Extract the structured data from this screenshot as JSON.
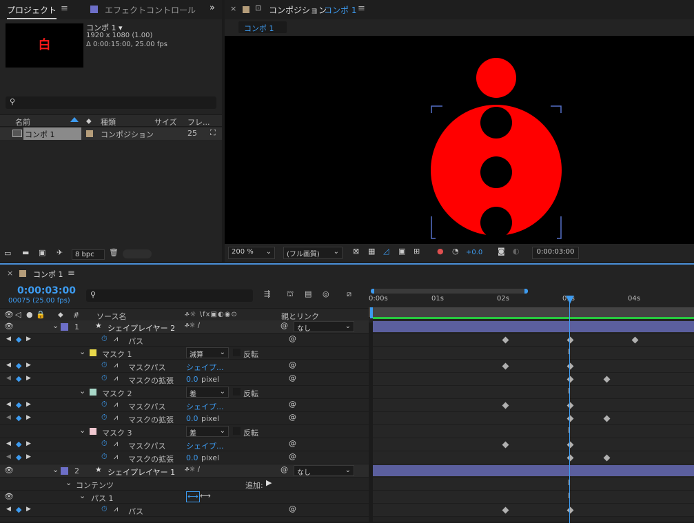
{
  "project_panel": {
    "tab_project": "プロジェクト",
    "tab_effect": "エフェクトコントロール ミ",
    "thumb_char": "白",
    "comp_name": "コンポ 1 ▾",
    "comp_res": "1920 x 1080 (1.00)",
    "comp_dur": "Δ 0:00:15:00, 25.00 fps",
    "col_name": "名前",
    "col_type": "種類",
    "col_size": "サイズ",
    "col_frame": "フレ...",
    "item_name": "コンポ 1",
    "item_type": "コンポジション",
    "item_fps": "25",
    "bpc": "8 bpc"
  },
  "comp_panel": {
    "title": "コンポジション",
    "title_name": "コンポ 1",
    "subtab": "コンポ 1",
    "zoom": "200 %",
    "quality": "(フル画質)",
    "exposure": "+0.0",
    "time": "0:00:03:00"
  },
  "timeline": {
    "tab": "コンポ 1",
    "timecode": "0:00:03:00",
    "frames": "00075 (25.00 fps)",
    "col_source": "ソース名",
    "col_parent": "親とリンク",
    "col_num": "#",
    "ruler": [
      "0:00s",
      "01s",
      "02s",
      "03s",
      "04s"
    ],
    "layers": [
      {
        "num": "1",
        "name": "シェイプレイヤー 2",
        "parent": "なし"
      },
      {
        "num": "2",
        "name": "シェイプレイヤー 1",
        "parent": "なし"
      }
    ],
    "rows": {
      "path": "パス",
      "mask1": "マスク 1",
      "mask2": "マスク 2",
      "mask3": "マスク 3",
      "maskpath": "マスクパス",
      "maskexp": "マスクの拡張",
      "mode1": "減算",
      "mode2": "差",
      "mode3": "差",
      "invert": "反転",
      "shape": "シェイプ...",
      "exp_val": "0.0",
      "exp_unit": "pixel",
      "contents": "コンテンツ",
      "add": "追加:",
      "path1": "パス 1"
    }
  },
  "colors": {
    "accent": "#3d9bf0",
    "layer_bar": "#5b5f9e",
    "red": "#ff0000",
    "mask1": "#e8d84a",
    "mask2": "#a8d8c8",
    "mask3": "#f0c8d0"
  }
}
